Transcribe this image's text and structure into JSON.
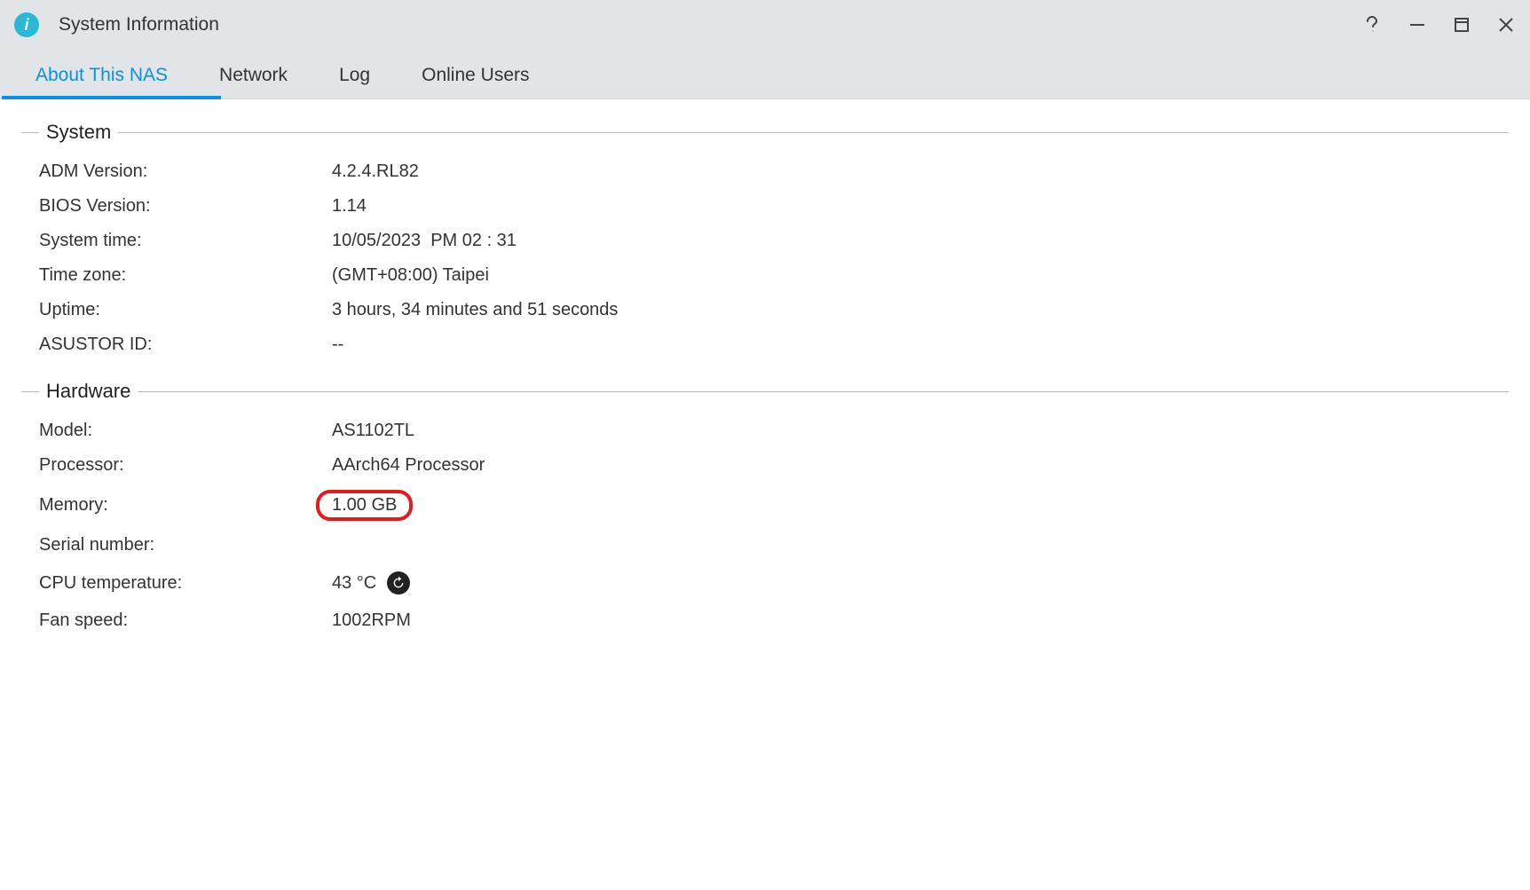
{
  "window": {
    "title": "System Information"
  },
  "tabs": [
    {
      "label": "About This NAS",
      "active": true
    },
    {
      "label": "Network",
      "active": false
    },
    {
      "label": "Log",
      "active": false
    },
    {
      "label": "Online Users",
      "active": false
    }
  ],
  "sections": {
    "system": {
      "title": "System",
      "rows": {
        "adm_version": {
          "label": "ADM Version:",
          "value": "4.2.4.RL82"
        },
        "bios_version": {
          "label": "BIOS Version:",
          "value": "1.14"
        },
        "system_time": {
          "label": "System time:",
          "value": "10/05/2023  PM 02 : 31"
        },
        "time_zone": {
          "label": "Time zone:",
          "value": "(GMT+08:00) Taipei"
        },
        "uptime": {
          "label": "Uptime:",
          "value": "3 hours, 34 minutes and 51 seconds"
        },
        "asustor_id": {
          "label": "ASUSTOR ID:",
          "value": "--"
        }
      }
    },
    "hardware": {
      "title": "Hardware",
      "rows": {
        "model": {
          "label": "Model:",
          "value": "AS1102TL"
        },
        "processor": {
          "label": "Processor:",
          "value": "AArch64 Processor"
        },
        "memory": {
          "label": "Memory:",
          "value": "1.00 GB"
        },
        "serial_number": {
          "label": "Serial number:",
          "value": ""
        },
        "cpu_temp": {
          "label": "CPU temperature:",
          "value": "43 °C"
        },
        "fan_speed": {
          "label": "Fan speed:",
          "value": "1002RPM"
        }
      }
    }
  }
}
